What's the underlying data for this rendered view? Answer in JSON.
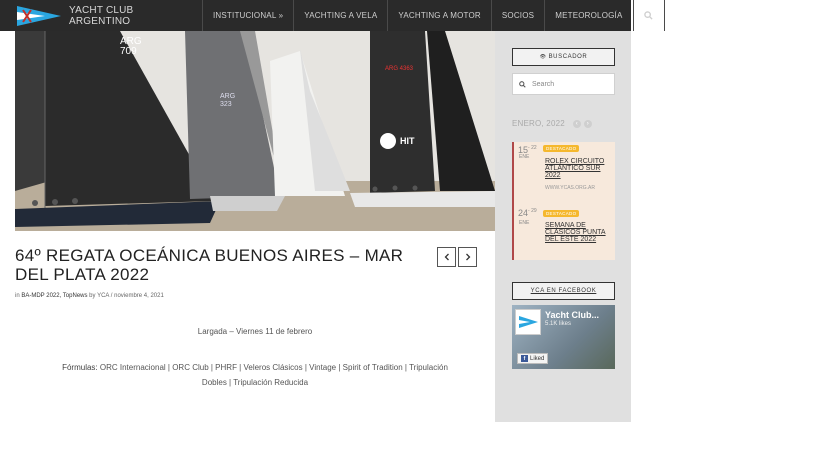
{
  "header": {
    "logo_line1": "YACHT CLUB",
    "logo_line2": "ARGENTINO",
    "nav": [
      {
        "label": "INSTITUCIONAL »"
      },
      {
        "label": "YACHTING A VELA"
      },
      {
        "label": "YACHTING A MOTOR"
      },
      {
        "label": "SOCIOS"
      },
      {
        "label": "METEOROLOGÍA"
      }
    ],
    "search_icon": "search-icon"
  },
  "post": {
    "title": "64º REGATA OCEÁNICA BUENOS AIRES – MAR DEL PLATA 2022",
    "meta_in": "in",
    "meta_categories": "BA-MDP 2022, TopNews",
    "meta_by": "by",
    "meta_author": "YCA",
    "meta_sep": "/",
    "meta_date": "noviembre 4, 2021",
    "body_line1": "Largada – Viernes 11 de febrero",
    "formulas_label": "Fórmulas:",
    "formulas_text": "ORC Internacional | ORC Club | PHRF | Veleros Clásicos | Vintage | Spirit of Tradition | Tripulación Dobles | Tripulación Reducida",
    "prev_icon": "chevron-left-icon",
    "next_icon": "chevron-right-icon",
    "hero_sail_numbers": [
      "ARG 709",
      "ARG 323",
      "ARG 4363",
      "HIT"
    ]
  },
  "sidebar": {
    "buscador_label": "BUSCADOR",
    "search_placeholder": "Search",
    "calendar_month": "ENERO, 2022",
    "events": [
      {
        "day": "15",
        "day_end": "- 22",
        "month": "ENE",
        "badge": "DESTACADO",
        "title": "ROLEX CIRCUITO ATLÁNTICO SUR 2022",
        "site": "WWW.YCAS.ORG.AR"
      },
      {
        "day": "24",
        "day_end": "- 29",
        "month": "ENE",
        "badge": "DESTACADO",
        "title": "SEMANA DE CLÁSICOS PUNTA DEL ESTE 2022",
        "site": ""
      }
    ],
    "facebook_label": "YCA EN FACEBOOK",
    "fb_page_name": "Yacht Club...",
    "fb_likes": "5.1K likes",
    "fb_liked": "Liked"
  },
  "colors": {
    "topbar": "#2a2a2a",
    "sidebar_bg": "#e0e0e0",
    "event_bg": "#f7e9dc",
    "event_accent": "#b04848",
    "badge": "#f5b82e",
    "logo_blue": "#2aa6e0"
  }
}
